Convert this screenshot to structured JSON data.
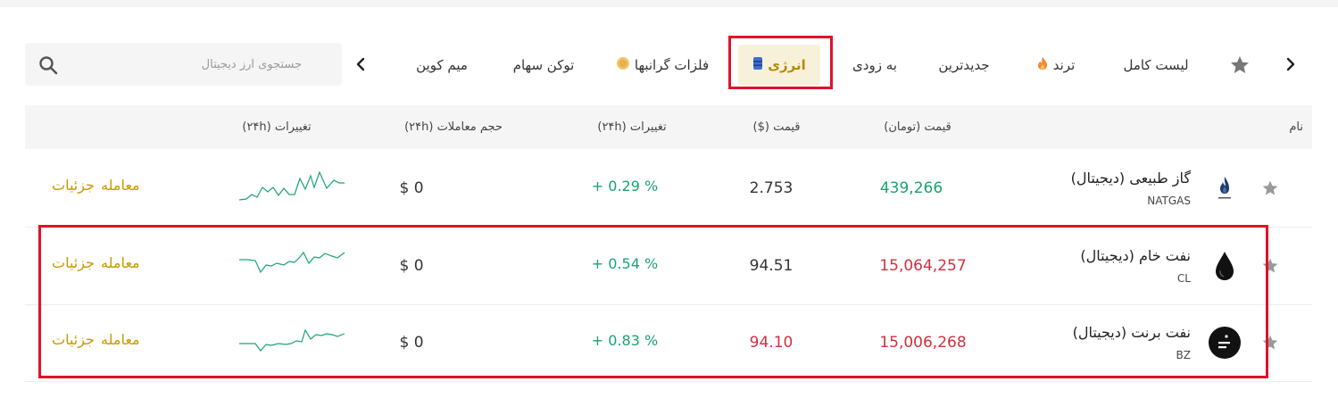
{
  "tabs": [
    {
      "label": "لیست کامل"
    },
    {
      "label": "ترند"
    },
    {
      "label": "جدیدترین"
    },
    {
      "label": "به زودی"
    },
    {
      "label": "انرژی"
    },
    {
      "label": "فلزات گرانبها"
    },
    {
      "label": "توکن سهام"
    },
    {
      "label": "میم کوین"
    }
  ],
  "active_tab": "انرژی",
  "search": {
    "placeholder": "جستجوی ارز دیجیتال"
  },
  "table": {
    "headers": {
      "name": "نام",
      "price_toman": "قیمت (تومان)",
      "price_usd": "قیمت ($)",
      "change_24h": "تغییرات (۲۴h)",
      "volume_24h": "حجم معاملات (۲۴h)",
      "chart_24h": "تغییرات (۲۴h)"
    },
    "rows": [
      {
        "name": "گاز طبیعی (دیجیتال)",
        "symbol": "NATGAS",
        "price_toman": "439,266",
        "price_usd": "2.753",
        "change": "+ 0.29 %",
        "volume": "$ 0",
        "trade": "معامله",
        "details": "جزئیات"
      },
      {
        "name": "نفت خام (دیجیتال)",
        "symbol": "CL",
        "price_toman": "15,064,257",
        "price_usd": "94.51",
        "change": "+ 0.54 %",
        "volume": "$ 0",
        "trade": "معامله",
        "details": "جزئیات"
      },
      {
        "name": "نفت برنت (دیجیتال)",
        "symbol": "BZ",
        "price_toman": "15,006,268",
        "price_usd": "94.10",
        "change": "+ 0.83 %",
        "volume": "$ 0",
        "trade": "معامله",
        "details": "جزئیات"
      }
    ]
  },
  "colors": {
    "accent": "#c79a00",
    "positive": "#1aa371",
    "negative": "#d0303f",
    "highlight": "#e0122a"
  }
}
